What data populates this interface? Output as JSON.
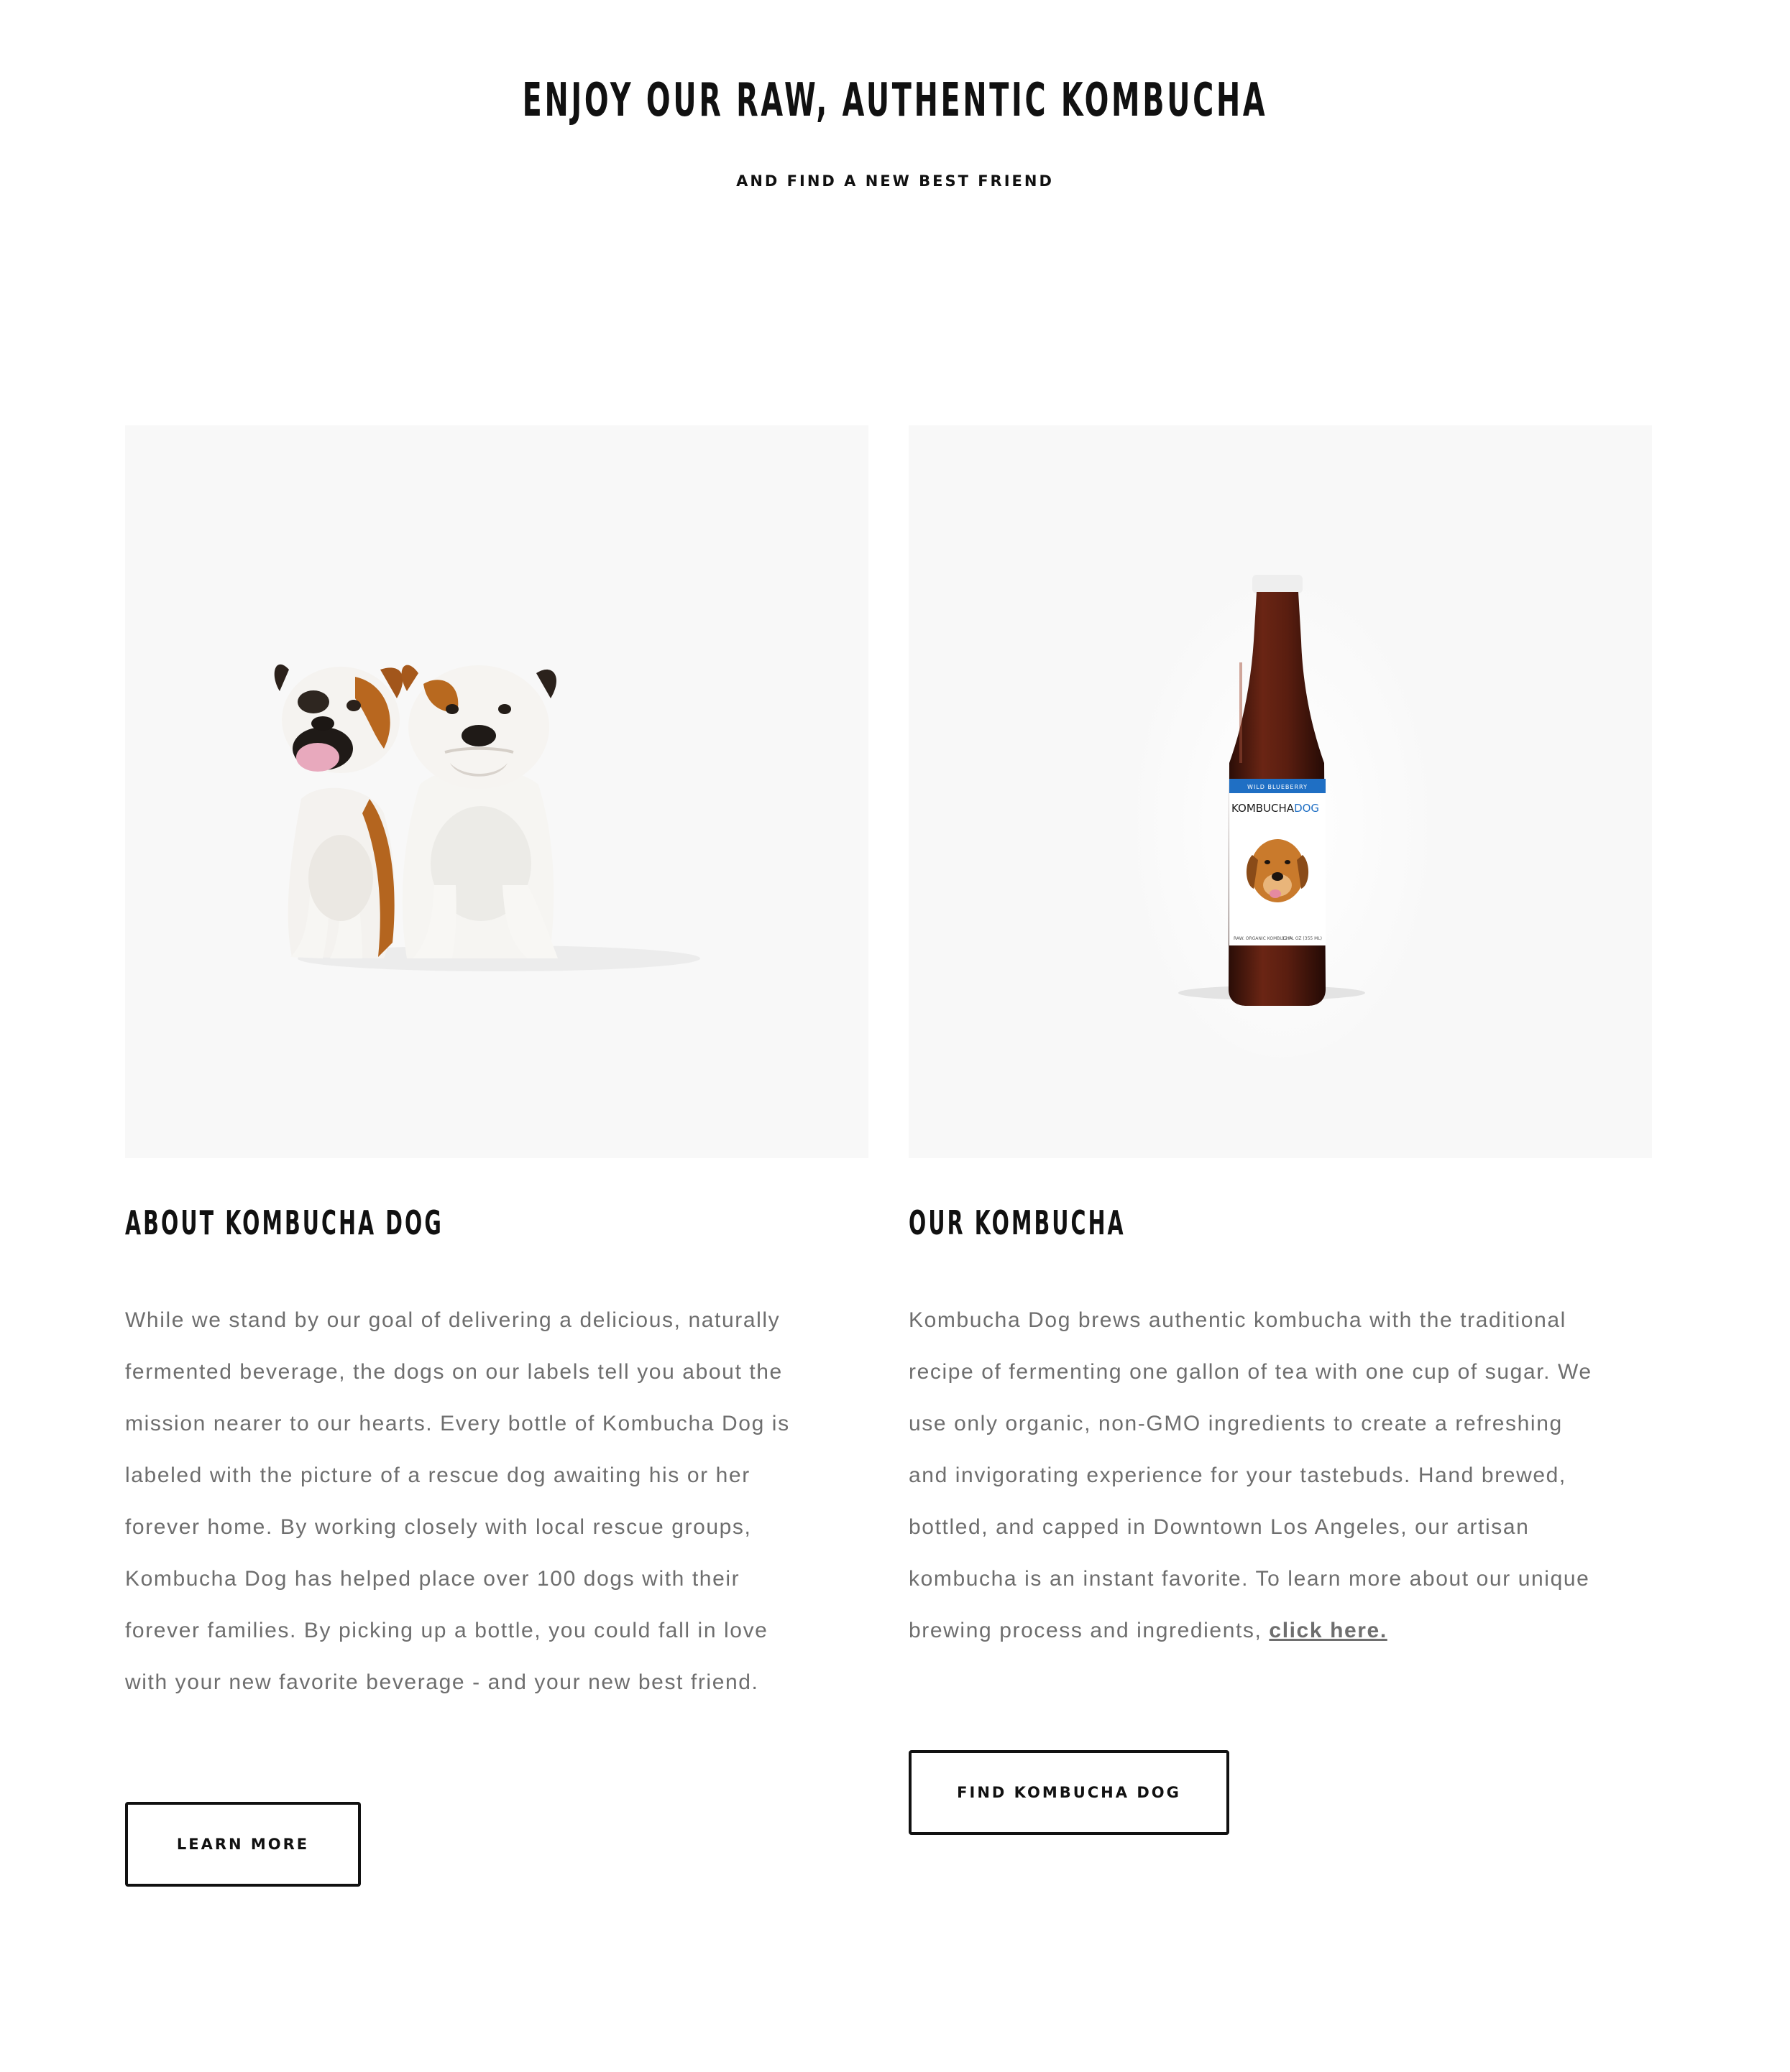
{
  "hero": {
    "title": "ENJOY OUR RAW, AUTHENTIC KOMBUCHA",
    "subtitle": "AND FIND A NEW BEST FRIEND"
  },
  "about": {
    "heading": "ABOUT KOMBUCHA DOG",
    "body": "While we stand by our goal of delivering a delicious, naturally fermented beverage, the dogs on our labels tell you about the mission nearer to our hearts. Every bottle of Kombucha Dog is labeled with the picture of a rescue dog awaiting his or her forever home. By working closely with local rescue groups, Kombucha Dog has helped place over 100 dogs with their forever families. By picking up a bottle, you could fall in love with your new favorite beverage - and your new best friend.",
    "button_label": "LEARN MORE"
  },
  "kombucha": {
    "heading": "OUR KOMBUCHA",
    "body": "Kombucha Dog brews authentic kombucha with the traditional recipe of fermenting one gallon of tea with one cup of sugar. We use only organic, non-GMO ingredients to create a refreshing and invigorating experience for your tastebuds. Hand brewed, bottled, and capped in Downtown Los Angeles, our artisan kombucha is an instant favorite. To learn more about our unique brewing process and ingredients,",
    "link_label": "click here.",
    "button_label": "FIND KOMBUCHA DOG"
  },
  "bottle_label": {
    "flavor": "WILD BLUEBERRY",
    "brand_part1": "KOMBUCHA",
    "brand_part2": "DOG",
    "footer_left": "RAW. ORGANIC KOMBUCHA",
    "footer_right": "12 FL OZ (355 ML)"
  },
  "colors": {
    "photo_bg": "#f8f8f8",
    "body_text": "#6e6e6e",
    "heading_text": "#111111",
    "label_blue": "#1f6fc4"
  }
}
